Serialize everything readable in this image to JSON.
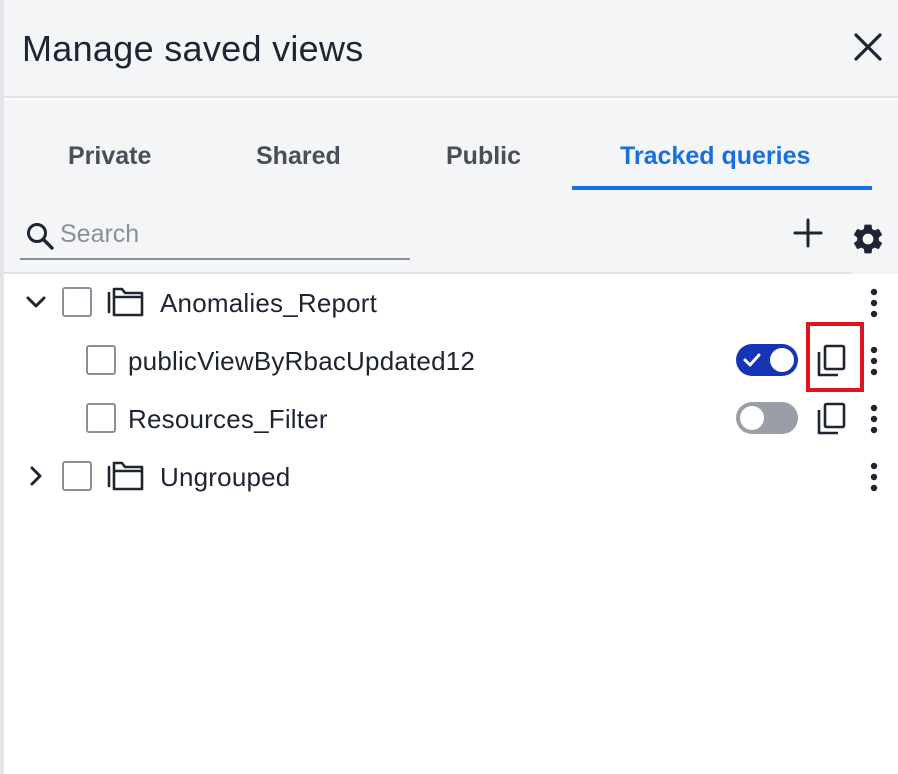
{
  "dialog": {
    "title": "Manage saved views"
  },
  "tabs": [
    {
      "label": "Private",
      "active": false
    },
    {
      "label": "Shared",
      "active": false
    },
    {
      "label": "Public",
      "active": false
    },
    {
      "label": "Tracked queries",
      "active": true
    }
  ],
  "search": {
    "placeholder": "Search",
    "value": ""
  },
  "tree": {
    "groups": [
      {
        "name": "Anomalies_Report",
        "expanded": true,
        "items": [
          {
            "name": "publicViewByRbacUpdated12",
            "tracked": true
          },
          {
            "name": "Resources_Filter",
            "tracked": false
          }
        ]
      },
      {
        "name": "Ungrouped",
        "expanded": false,
        "items": []
      }
    ]
  },
  "icons": {
    "close": "close-icon",
    "search": "search-icon",
    "add": "plus-icon",
    "settings": "gear-icon",
    "folder": "folder-stack-icon",
    "copy": "copy-icon",
    "more": "kebab-menu-icon"
  },
  "colors": {
    "accent": "#1a6fe0",
    "toggle_on": "#1535b5",
    "toggle_off": "#9a9ea6",
    "highlight": "#e0141e",
    "header_bg": "#f4f5f7"
  }
}
